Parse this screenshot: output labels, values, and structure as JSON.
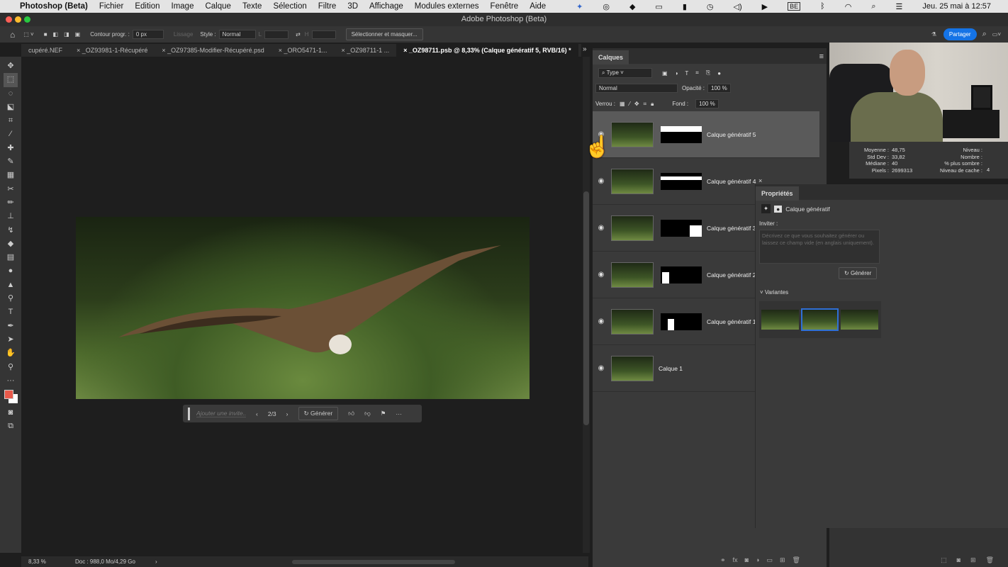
{
  "menubar": {
    "app": "Photoshop (Beta)",
    "items": [
      "Fichier",
      "Edition",
      "Image",
      "Calque",
      "Texte",
      "Sélection",
      "Filtre",
      "3D",
      "Affichage",
      "Modules externes",
      "Fenêtre",
      "Aide"
    ],
    "lang": "BE",
    "clock": "Jeu. 25 mai à 12:57"
  },
  "window": {
    "title": "Adobe Photoshop (Beta)"
  },
  "options": {
    "feather_label": "Contour progr. :",
    "feather_value": "0 px",
    "smooth_label": "Lissage",
    "style_label": "Style :",
    "style_value": "Normal",
    "w_label": "L",
    "h_label": "H",
    "select_mask": "Sélectionner et masquer...",
    "share": "Partager"
  },
  "tabs": [
    {
      "label": "cupéré.NEF"
    },
    {
      "label": "_OZ93981-1-Récupéré"
    },
    {
      "label": "_OZ97385-Modifier-Récupéré.psd"
    },
    {
      "label": "_ORO5471-1..."
    },
    {
      "label": "_OZ98711-1 ..."
    },
    {
      "label": "_OZ98711.psb @ 8,33% (Calque génératif 5, RVB/16) *",
      "active": true
    }
  ],
  "genbar": {
    "placeholder": "Ajouter une invite...",
    "page": "2/3",
    "generate": "Générer"
  },
  "status": {
    "zoom": "8,33 %",
    "doc": "Doc : 988,0 Mo/4,29 Go"
  },
  "layers": {
    "title": "Calques",
    "filter": "Type",
    "blend": "Normal",
    "opacity_label": "Opacité :",
    "opacity": "100 %",
    "lock_label": "Verrou :",
    "fill_label": "Fond :",
    "fill": "100 %",
    "items": [
      {
        "name": "Calque génératif 5",
        "selected": true
      },
      {
        "name": "Calque génératif 4"
      },
      {
        "name": "Calque génératif 3"
      },
      {
        "name": "Calque génératif 2"
      },
      {
        "name": "Calque génératif 1"
      },
      {
        "name": "Calque 1"
      }
    ]
  },
  "histogram": {
    "mean_label": "Moyenne :",
    "mean": "48,75",
    "std_label": "Std Dev :",
    "std": "33,82",
    "median_label": "Médiane :",
    "median": "40",
    "pixels_label": "Pixels :",
    "pixels": "2699313",
    "level_label": "Niveau :",
    "count_label": "Nombre :",
    "dark_label": "% plus sombre :",
    "cache_label": "Niveau de cache :",
    "cache": "4"
  },
  "properties": {
    "title": "Propriétés",
    "layer_type": "Calque génératif",
    "prompt_label": "Inviter :",
    "prompt_placeholder": "Décrivez ce que vous souhaitez générer ou laissez ce champ vide (en anglais uniquement).",
    "generate": "Générer",
    "variants_label": "Variantes",
    "selected_variant": 2
  },
  "colors": {
    "foreground": "#e8594a",
    "background": "#ffffff",
    "accent": "#1473e6",
    "variant_border": "#2f6fd6"
  }
}
